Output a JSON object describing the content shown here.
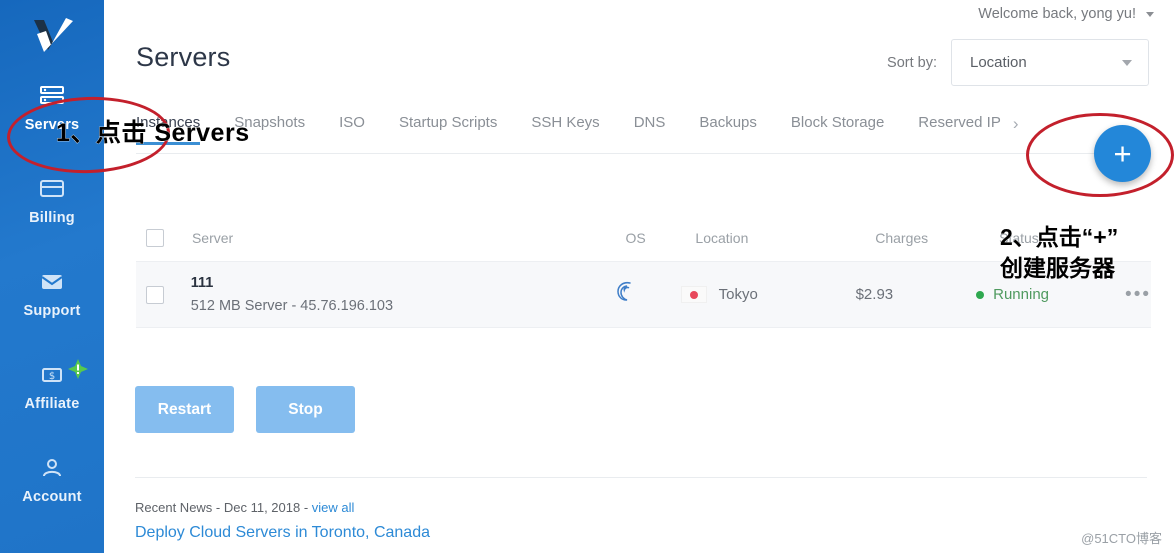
{
  "sidebar": {
    "logo_name": "vultr-logo",
    "items": [
      {
        "label": "Servers",
        "icon": "servers-icon",
        "active": true
      },
      {
        "label": "Billing",
        "icon": "billing-card-icon",
        "active": false
      },
      {
        "label": "Support",
        "icon": "envelope-icon",
        "active": false
      },
      {
        "label": "Affiliate",
        "icon": "dollar-bill-icon",
        "active": false,
        "badge": "!"
      },
      {
        "label": "Account",
        "icon": "person-icon",
        "active": false
      }
    ]
  },
  "header": {
    "welcome": "Welcome back, yong yu!",
    "page_title": "Servers",
    "sort_label": "Sort by:",
    "sort_value": "Location"
  },
  "tabs": [
    {
      "label": "Instances",
      "active": true
    },
    {
      "label": "Snapshots",
      "active": false
    },
    {
      "label": "ISO",
      "active": false
    },
    {
      "label": "Startup Scripts",
      "active": false
    },
    {
      "label": "SSH Keys",
      "active": false
    },
    {
      "label": "DNS",
      "active": false
    },
    {
      "label": "Backups",
      "active": false
    },
    {
      "label": "Block Storage",
      "active": false
    },
    {
      "label": "Reserved IP",
      "active": false
    }
  ],
  "tab_overflow_icon": "chevron-right-icon",
  "fab": {
    "label": "+",
    "color": "#2387d9"
  },
  "table": {
    "columns": [
      "Server",
      "OS",
      "Location",
      "Charges",
      "Status"
    ],
    "rows": [
      {
        "name": "111",
        "details": "512 MB Server - 45.76.196.103",
        "os": "debian-icon",
        "location": "Tokyo",
        "flag": "japan-flag",
        "charges": "$2.93",
        "status": "Running",
        "status_color": "#2fa84f",
        "more": "•••"
      }
    ]
  },
  "buttons": {
    "restart": "Restart",
    "stop": "Stop"
  },
  "news": {
    "meta_prefix": "Recent News - Dec 11, 2018 - ",
    "view_all": "view all",
    "headline": "Deploy Cloud Servers in Toronto, Canada"
  },
  "watermark": "@51CTO博客",
  "annotations": [
    {
      "id": "step1",
      "text": "1、点击 Servers"
    },
    {
      "id": "step2",
      "text": "2、点击“+”\n创建服务器"
    }
  ]
}
